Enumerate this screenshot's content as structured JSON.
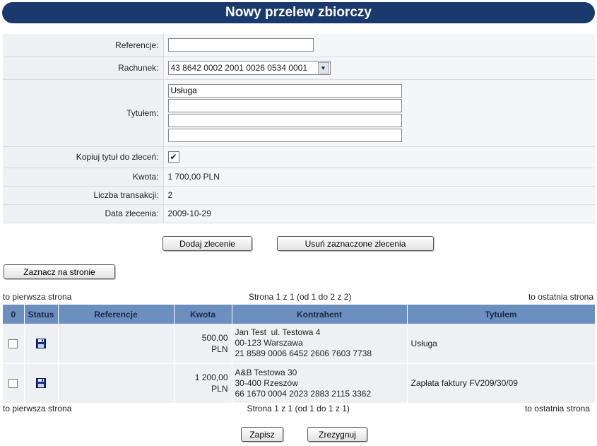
{
  "header": {
    "title": "Nowy przelew zbiorczy"
  },
  "form": {
    "referencje_label": "Referencje:",
    "referencje_value": "",
    "rachunek_label": "Rachunek:",
    "rachunek_value": "43 8642 0002 2001 0026 0534 0001",
    "tytulem_label": "Tytułem:",
    "tytulem_lines": [
      "Usługa",
      "",
      "",
      ""
    ],
    "kopiuj_label": "Kopiuj tytuł do zleceń:",
    "kopiuj_checked": "✔",
    "kwota_label": "Kwota:",
    "kwota_value": "1 700,00 PLN",
    "liczba_label": "Liczba transakcji:",
    "liczba_value": "2",
    "data_label": "Data zlecenia:",
    "data_value": "2009-10-29"
  },
  "buttons": {
    "add": "Dodaj zlecenie",
    "remove": "Usuń zaznaczone zlecenia",
    "mark_page": "Zaznacz na stronie",
    "save": "Zapisz",
    "cancel": "Zrezygnuj"
  },
  "nav_top": {
    "first": "to pierwsza strona",
    "info": "Strona 1 z 1 (od 1 do 2 z 2)",
    "last": "to ostatnia strona"
  },
  "nav_bottom": {
    "first": "to pierwsza strona",
    "info": "Strona 1 z 1 (od 1 do 1 z 1)",
    "last": "to ostatnia strona"
  },
  "table": {
    "headers": [
      "0",
      "Status",
      "Referencje",
      "Kwota",
      "Kontrahent",
      "Tytułem"
    ],
    "rows": [
      {
        "status_icon": "floppy-disk-icon",
        "referencje": "",
        "kwota_amount": "500,00",
        "kwota_currency": "PLN",
        "kontrahent": [
          "Jan Test  ul. Testowa 4",
          "00-123 Warszawa",
          "21 8589 0006 6452 2606 7603 7738"
        ],
        "tytulem": "Usługa"
      },
      {
        "status_icon": "floppy-disk-icon",
        "referencje": "",
        "kwota_amount": "1 200,00",
        "kwota_currency": "PLN",
        "kontrahent": [
          "A&B Testowa 30",
          "30-400 Rzeszów",
          "66 1670 0004 2023 2883 2115 3362"
        ],
        "tytulem": "Zapłata faktury FV209/30/09"
      }
    ]
  },
  "colors": {
    "title_bar": "#1a3a6e",
    "table_header": "#6b8fbf",
    "row_bg": "#eef0f3"
  }
}
